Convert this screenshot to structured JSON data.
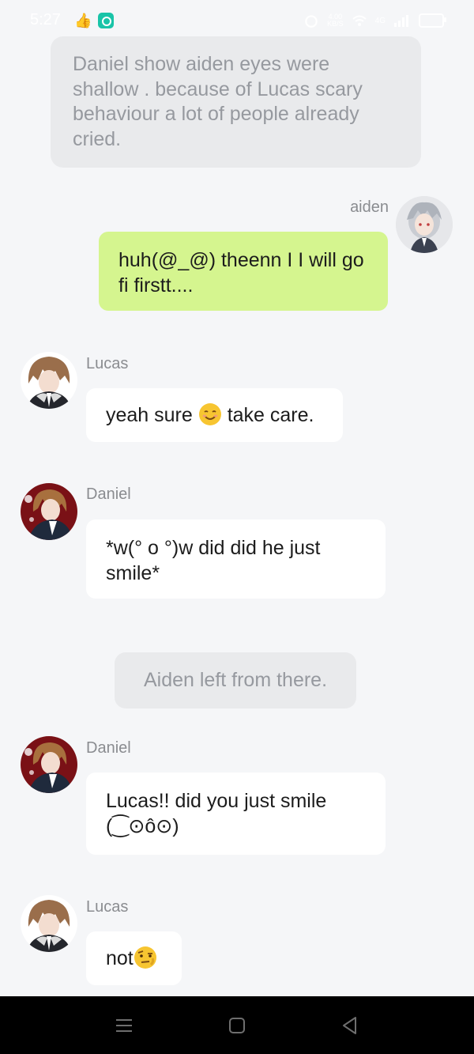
{
  "status_bar": {
    "time": "5:27",
    "speed_value": "4.00",
    "speed_unit": "KB/S",
    "network_label": "4G",
    "battery_percent": 57
  },
  "messages": [
    {
      "type": "narration",
      "text": "Daniel show aiden eyes were shallow . because of Lucas scary behaviour a lot of people already cried."
    },
    {
      "type": "outgoing",
      "sender": "aiden",
      "text": "huh(@_@) theenn I I will go fi firstt...."
    },
    {
      "type": "incoming",
      "sender": "Lucas",
      "text_before": "yeah sure ",
      "emoji": "smiling-face-icon",
      "text_after": " take care."
    },
    {
      "type": "incoming",
      "sender": "Daniel",
      "text": "*w(° o °)w did did he just smile*"
    },
    {
      "type": "narration_center",
      "text": "Aiden left from there."
    },
    {
      "type": "incoming",
      "sender": "Daniel",
      "text": "Lucas!! did you just smile (⁐⊙ô⊙)"
    },
    {
      "type": "incoming",
      "sender": "Lucas",
      "text_before": "not",
      "emoji": "raised-eyebrow-face-icon"
    }
  ],
  "nav_bar": {
    "menu_icon": "menu-icon",
    "home_icon": "home-icon",
    "back_icon": "back-icon"
  },
  "colors": {
    "background": "#f5f6f8",
    "outgoing_bubble": "#d5f58f",
    "incoming_bubble": "#ffffff",
    "narration_bubble": "#e9eaec"
  }
}
